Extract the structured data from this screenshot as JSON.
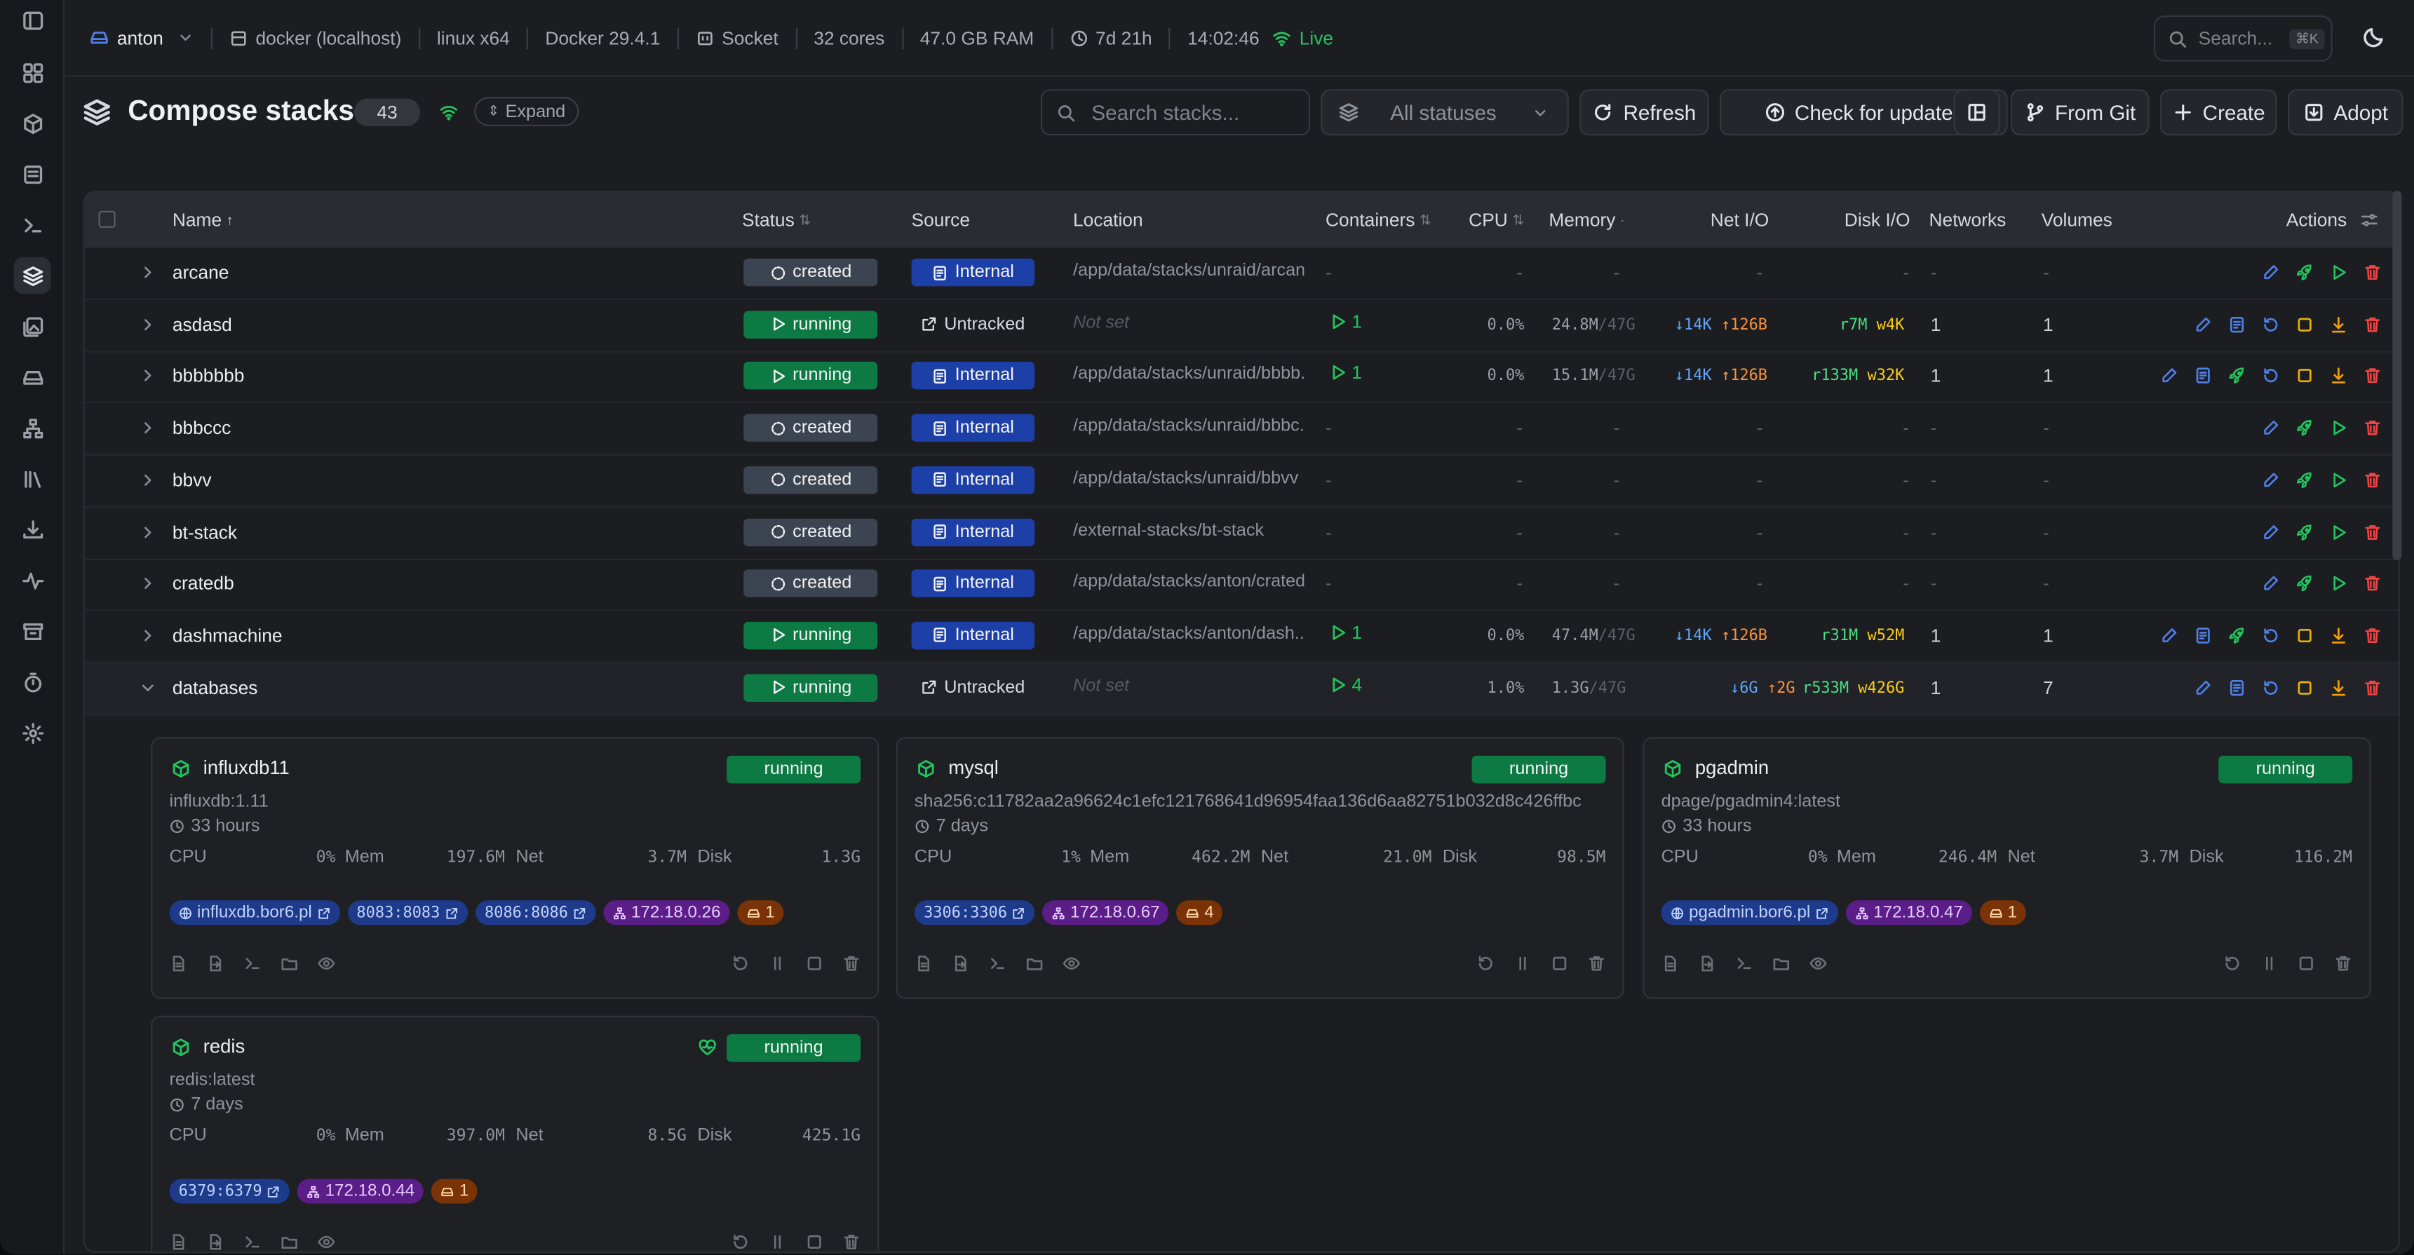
{
  "topbar": {
    "user": "anton",
    "environment": "docker (localhost)",
    "platform": "linux x64",
    "docker_version": "Docker 29.4.1",
    "connection": "Socket",
    "cores": "32 cores",
    "ram": "47.0 GB RAM",
    "uptime": "7d 21h",
    "time": "14:02:46",
    "live": "Live",
    "search_placeholder": "Search...",
    "search_shortcut": "⌘K"
  },
  "header": {
    "title": "Compose stacks",
    "count": "43",
    "expand_label": "Expand",
    "search_placeholder": "Search stacks...",
    "status_filter": "All statuses",
    "refresh": "Refresh",
    "check_updates": "Check for updates",
    "from_git": "From Git",
    "create": "Create",
    "adopt": "Adopt"
  },
  "columns": [
    "Name",
    "Status",
    "Source",
    "Location",
    "Containers",
    "CPU",
    "Memory",
    "Net I/O",
    "Disk I/O",
    "Networks",
    "Volumes",
    "Actions"
  ],
  "rows": [
    {
      "name": "arcane",
      "status": "created",
      "source": "Internal",
      "location": "/app/data/stacks/unraid/arcane",
      "containers": "-",
      "cpu": "-",
      "mem": "-",
      "mem_max": "",
      "net_down": "-",
      "net_up": "",
      "disk_r": "-",
      "disk_w": "",
      "networks": "-",
      "volumes": "-"
    },
    {
      "name": "asdasd",
      "status": "running",
      "source": "Untracked",
      "location": "Not set",
      "containers": "1",
      "cpu": "0.0%",
      "mem": "24.8M",
      "mem_max": "/47G",
      "net_down": "↓14K",
      "net_up": "↑126B",
      "disk_r": "r7M",
      "disk_w": "w4K",
      "networks": "1",
      "volumes": "1"
    },
    {
      "name": "bbbbbbb",
      "status": "running",
      "source": "Internal",
      "location": "/app/data/stacks/unraid/bbbb...",
      "containers": "1",
      "cpu": "0.0%",
      "mem": "15.1M",
      "mem_max": "/47G",
      "net_down": "↓14K",
      "net_up": "↑126B",
      "disk_r": "r133M",
      "disk_w": "w32K",
      "networks": "1",
      "volumes": "1"
    },
    {
      "name": "bbbccc",
      "status": "created",
      "source": "Internal",
      "location": "/app/data/stacks/unraid/bbbc...",
      "containers": "-",
      "cpu": "-",
      "mem": "-",
      "mem_max": "",
      "net_down": "-",
      "net_up": "",
      "disk_r": "-",
      "disk_w": "",
      "networks": "-",
      "volumes": "-"
    },
    {
      "name": "bbvv",
      "status": "created",
      "source": "Internal",
      "location": "/app/data/stacks/unraid/bbvv",
      "containers": "-",
      "cpu": "-",
      "mem": "-",
      "mem_max": "",
      "net_down": "-",
      "net_up": "",
      "disk_r": "-",
      "disk_w": "",
      "networks": "-",
      "volumes": "-"
    },
    {
      "name": "bt-stack",
      "status": "created",
      "source": "Internal",
      "location": "/external-stacks/bt-stack",
      "containers": "-",
      "cpu": "-",
      "mem": "-",
      "mem_max": "",
      "net_down": "-",
      "net_up": "",
      "disk_r": "-",
      "disk_w": "",
      "networks": "-",
      "volumes": "-"
    },
    {
      "name": "cratedb",
      "status": "created",
      "source": "Internal",
      "location": "/app/data/stacks/anton/cratedb",
      "containers": "-",
      "cpu": "-",
      "mem": "-",
      "mem_max": "",
      "net_down": "-",
      "net_up": "",
      "disk_r": "-",
      "disk_w": "",
      "networks": "-",
      "volumes": "-"
    },
    {
      "name": "dashmachine",
      "status": "running",
      "source": "Internal",
      "location": "/app/data/stacks/anton/dash...",
      "containers": "1",
      "cpu": "0.0%",
      "mem": "47.4M",
      "mem_max": "/47G",
      "net_down": "↓14K",
      "net_up": "↑126B",
      "disk_r": "r31M",
      "disk_w": "w52M",
      "networks": "1",
      "volumes": "1"
    },
    {
      "name": "databases",
      "status": "running",
      "source": "Untracked",
      "location": "Not set",
      "containers": "4",
      "cpu": "1.0%",
      "mem": "1.3G",
      "mem_max": "/47G",
      "net_down": "↓6G",
      "net_up": "↑2G",
      "disk_r": "r533M",
      "disk_w": "w426G",
      "networks": "1",
      "volumes": "7"
    }
  ],
  "containers": [
    {
      "name": "influxdb11",
      "status": "running",
      "image": "influxdb:1.11",
      "age": "33 hours",
      "cpu": "0%",
      "mem": "197.6M",
      "net": "3.7M",
      "disk": "1.3G",
      "link": "influxdb.bor6.pl",
      "ports": [
        "8083:8083",
        "8086:8086"
      ],
      "ip": "172.18.0.26",
      "volumes": "1"
    },
    {
      "name": "mysql",
      "status": "running",
      "image": "sha256:c11782aa2a96624c1efc121768641d96954faa136d6aa82751b032d8c426ffbc",
      "age": "7 days",
      "cpu": "1%",
      "mem": "462.2M",
      "net": "21.0M",
      "disk": "98.5M",
      "link": "",
      "ports": [
        "3306:3306"
      ],
      "ip": "172.18.0.67",
      "volumes": "4"
    },
    {
      "name": "pgadmin",
      "status": "running",
      "image": "dpage/pgadmin4:latest",
      "age": "33 hours",
      "cpu": "0%",
      "mem": "246.4M",
      "net": "3.7M",
      "disk": "116.2M",
      "link": "pgadmin.bor6.pl",
      "ports": [],
      "ip": "172.18.0.47",
      "volumes": "1"
    },
    {
      "name": "redis",
      "status": "running",
      "image": "redis:latest",
      "age": "7 days",
      "cpu": "0%",
      "mem": "397.0M",
      "net": "8.5G",
      "disk": "425.1G",
      "link": "",
      "ports": [
        "6379:6379"
      ],
      "ip": "172.18.0.44",
      "volumes": "1"
    }
  ],
  "stat_labels": {
    "cpu": "CPU",
    "mem": "Mem",
    "net": "Net",
    "disk": "Disk"
  },
  "colors": {
    "running": "#0d7a43",
    "created": "#3d4451",
    "internal": "#1d3fa8",
    "live": "#22c55e",
    "accent_blue": "#4f7fe8",
    "danger": "#ef4444"
  }
}
